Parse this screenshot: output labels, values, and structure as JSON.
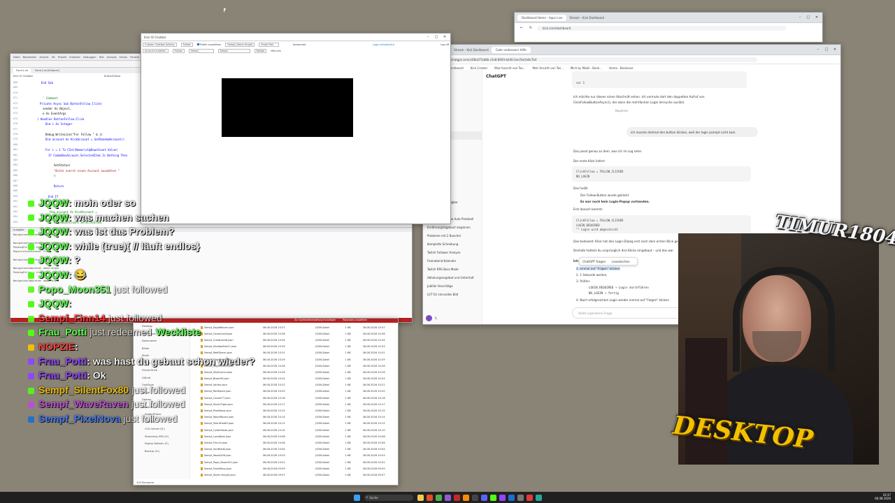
{
  "top_window": {
    "tabs": [
      "Dashboard Home - Aqua Live",
      "Stream - Kick Dashboard"
    ],
    "url": "kick.com/dashboard"
  },
  "kick_tool": {
    "title": "Kick IO Chatbot",
    "row1": [
      "Custom Chatbot Activity",
      "Follow",
      "Profile auswählen",
      "Sempf_Storm Knight",
      "Email Fehl"
    ],
    "row2": [
      "Account erstellen",
      "Follow",
      "Sempf_",
      "Sempf",
      "Reload",
      "Miliz.dm"
    ],
    "status_label": "Verwendet",
    "status_value": "Login erforderlich",
    "logout": "Log off"
  },
  "ide": {
    "menu": [
      "Datei",
      "Bearbeiten",
      "Ansicht",
      "Git",
      "Projekt",
      "Erstellen",
      "Debuggen",
      "Test",
      "Analyse",
      "Extras",
      "Fenster",
      "Hilfe"
    ],
    "tab": "Form1.vb",
    "tab2": "Form1.vb [Entwurf]",
    "dropdown_left": "Kick IO Chatbot",
    "dropdown_right": "ButtonFollow",
    "line_numbers": [
      "668",
      "669",
      "670",
      "671",
      "672",
      "673",
      "674",
      "675",
      "676",
      "677",
      "678",
      "679",
      "680",
      "681",
      "682",
      "683",
      "684",
      "685",
      "686",
      "687",
      "688",
      "689",
      "690",
      "691",
      "692",
      "693",
      "694",
      "695"
    ],
    "code": [
      "End Sub",
      "",
      "",
      "' Comment",
      "Private Async Sub ButtonFollow_Click(",
      "sender As Object,",
      "e As EventArgs",
      ") Handles ButtonFollow.Click",
      "Dim i As Integer",
      "",
      "Debug.WriteLine(\"For Follow \" & i)",
      "Dim account As KickAccount = GetRandomAccount()",
      "",
      "For i = 1 To CInt(NumericUpDownCount.Value)",
      "If ComboBoxAccount.SelectedItem Is Nothing Then",
      "",
      "SetStatus(",
      "\"Bitte zuerst einen Account auswählen \"",
      ")",
      "",
      "Return",
      "",
      "End If",
      "",
      "",
      "'Dim account As KickAccount =",
      "CType(CType(",
      "ComboBoxAccount.SelectedItem,"
    ],
    "output_title": "Ausgabe",
    "output_lines": [
      "NavigationCompleted: about:blank",
      "",
      "NavigationCompleted: about:blank",
      "PendingFollow = true",
      "RegistrationSuccess: True",
      "",
      "NavigationCompleted: about:blank",
      "",
      "NavigationCompleted: about:blank",
      "PendingFollow = true",
      "",
      "NavigationCompleted: about:blank"
    ]
  },
  "chat": {
    "lines": [
      {
        "user": "JQQW",
        "msg": ": moin oder so",
        "type": "msg"
      },
      {
        "user": "JQQW",
        "msg": ": was machen sachen",
        "type": "msg"
      },
      {
        "user": "JQQW",
        "msg": ": was ist das Problem?",
        "type": "msg"
      },
      {
        "user": "JQQW",
        "msg": ": while (true){ // läuft endlos}",
        "type": "msg"
      },
      {
        "user": "JQQW",
        "msg": ": ?",
        "type": "msg"
      },
      {
        "user": "JQQW",
        "msg": ": 😂",
        "type": "msg"
      },
      {
        "user": "Popo_Moon351",
        "msg": "just followed",
        "type": "follow"
      },
      {
        "user": "JQQW",
        "msg": ":",
        "type": "msg"
      },
      {
        "user": "Sempf_Finn14",
        "msg": "just followed",
        "type": "follow"
      },
      {
        "user": "Frau_Potti",
        "msg": "just redeemed",
        "type": "redeem",
        "extra": "Weckliste"
      },
      {
        "user": "NOPZIE",
        "msg": ":",
        "type": "msg"
      },
      {
        "user": "Frau_Potti",
        "msg": ": was hast du gebaut schon wieder?",
        "type": "msg"
      },
      {
        "user": "Frau_Potti",
        "msg": ": Ok",
        "type": "msg"
      },
      {
        "user": "Sempf_SilentFox80",
        "msg": "just followed",
        "type": "follow"
      },
      {
        "user": "Sempf_WaveRaven",
        "msg": "just followed",
        "type": "follow"
      },
      {
        "user": "Sempf_PixelNova",
        "msg": "just followed",
        "type": "follow"
      }
    ]
  },
  "explorer": {
    "sidebar": [
      "Desktop",
      "Downloads",
      "Dokumente",
      "Bilder",
      "Musik",
      "Videos",
      "iCloud Drive",
      "Github",
      "OneDrive",
      "Spiele",
      "Games",
      "Dieser PC",
      "Apple iPhone",
      "SSD (C:)",
      "CLD Games (D:)",
      "Streaming SSD (E:)",
      "Eigene Dateien (F:)",
      "Backup (G:)"
    ],
    "files": [
      [
        "Sempf_EagleBloom.json",
        "06.08.2026 10:37",
        "JSON-Datei",
        "1 KB",
        "06.08.2026 10:37"
      ],
      [
        "Sempf_OceanLeaf.json",
        "06.08.2026 10:36",
        "JSON-Datei",
        "1 KB",
        "06.08.2026 10:36"
      ],
      [
        "Sempf_CrestLeon8.json",
        "06.08.2026 10:34",
        "JSON-Datei",
        "1 KB",
        "06.08.2026 10:34"
      ],
      [
        "Sempf_ShadowFox21.json",
        "06.08.2026 10:33",
        "JSON-Datei",
        "1 KB",
        "06.08.2026 10:33"
      ],
      [
        "Sempf_WolfStorm.json",
        "06.08.2026 10:31",
        "JSON-Datei",
        "1 KB",
        "06.08.2026 10:31"
      ],
      [
        "Sempf_GlowRider.json",
        "06.08.2026 10:29",
        "JSON-Datei",
        "1 KB",
        "06.08.2026 10:29"
      ],
      [
        "Sempf_NightFalcon.json",
        "06.08.2026 10:28",
        "JSON-Datei",
        "1 KB",
        "06.08.2026 10:28"
      ],
      [
        "Sempf_SkyRunner.json",
        "06.08.2026 10:26",
        "JSON-Datei",
        "1 KB",
        "06.08.2026 10:26"
      ],
      [
        "Sempf_Blaze99.json",
        "06.08.2026 10:24",
        "JSON-Datei",
        "1 KB",
        "06.08.2026 10:24"
      ],
      [
        "Sempf_Vortex.json",
        "06.08.2026 10:22",
        "JSON-Datei",
        "1 KB",
        "06.08.2026 10:22"
      ],
      [
        "Sempf_RedSpark.json",
        "06.08.2026 10:20",
        "JSON-Datei",
        "1 KB",
        "06.08.2026 10:20"
      ],
      [
        "Sempf_Comet77.json",
        "06.08.2026 10:18",
        "JSON-Datei",
        "1 KB",
        "06.08.2026 10:18"
      ],
      [
        "Sempf_StormTiger.json",
        "06.08.2026 10:17",
        "JSON-Datei",
        "1 KB",
        "06.08.2026 10:17"
      ],
      [
        "Sempf_PixelNova.json",
        "06.08.2026 10:15",
        "JSON-Datei",
        "1 KB",
        "06.08.2026 10:15"
      ],
      [
        "Sempf_WaveRaven.json",
        "06.08.2026 10:14",
        "JSON-Datei",
        "1 KB",
        "06.08.2026 10:14"
      ],
      [
        "Sempf_SilentFox80.json",
        "06.08.2026 10:12",
        "JSON-Datei",
        "1 KB",
        "06.08.2026 10:12"
      ],
      [
        "Sempf_CyberHawk.json",
        "06.08.2026 10:10",
        "JSON-Datei",
        "1 KB",
        "06.08.2026 10:10"
      ],
      [
        "Sempf_LunaByte.json",
        "06.08.2026 10:08",
        "JSON-Datei",
        "1 KB",
        "06.08.2026 10:08"
      ],
      [
        "Sempf_Finn14.json",
        "06.08.2026 10:06",
        "JSON-Datei",
        "1 KB",
        "06.08.2026 10:06"
      ],
      [
        "Sempf_IronBlade.json",
        "06.08.2026 10:04",
        "JSON-Datei",
        "1 KB",
        "06.08.2026 10:04"
      ],
      [
        "Sempf_NeonDrift.json",
        "06.08.2026 10:03",
        "JSON-Datei",
        "1 KB",
        "06.08.2026 10:03"
      ],
      [
        "Sempf_Popo_Moon351.json",
        "06.08.2026 10:01",
        "JSON-Datei",
        "1 KB",
        "06.08.2026 10:01"
      ],
      [
        "Sempf_FrostWing.json",
        "06.08.2026 09:59",
        "JSON-Datei",
        "1 KB",
        "06.08.2026 09:59"
      ],
      [
        "Sempf_Storm Knight.json",
        "06.08.2026 09:57",
        "JSON-Datei",
        "1 KB",
        "06.08.2026 09:57"
      ]
    ],
    "status": "103 Elemente",
    "toolbar_items": [
      "Zur Quellcodeverwaltung hinzufügen",
      "Repository auswählen"
    ]
  },
  "browser": {
    "tabs": [
      "Stream - Kick Dashboard",
      "Code verbessern Hilfe"
    ],
    "url": "chatgpt.com/c/68a1f7ab8b-c5e8-8093-b4d0-2ee7be5e8c7b4",
    "bookmarks": [
      "Stream - Kick Dashboard",
      "Kick Creator",
      "Mod Ansicht von Twi...",
      "Meh Ansicht von Twi...",
      "Mich by Mobil - Bank...",
      "Home - Bookrose"
    ],
    "app_title": "ChatGPT",
    "sidebar": [
      "Neuer Chat",
      "Chats durchsuchen",
      "Bibliothek",
      "Sora",
      "GPTs",
      "Codex",
      "Projekte",
      "Kick IO Hilfe",
      "Chats",
      "Kick Follower",
      "Stream Aufbau",
      "Follower-Bot gut",
      "Login Timing",
      "ChatGPT OpenAI",
      "Kick Chatbot API",
      "Discord Bot Verfügbar",
      "Kick Raid Bank",
      "Gewichtsabnahme Auto Protokoll",
      "Ernährungstagebuch beginnen",
      "Probleme mit 2 Buecher",
      "Komplette Schreibung",
      "Twitch Follower Analyse",
      "Feierabend Kalender",
      "Twitch RPG Boss Mode",
      "Abholungsangebot und Unterhalt",
      "Jubiläe Vorschläge",
      "LUT für sinnvolles Bild"
    ],
    "messages": {
      "code_top": "var 1",
      "p1": "Ich möchte nur diesen einen Abschnitt sehen. Ich vermute dort den doppelten Aufruf von",
      "p1b": "ClickFollowButtonAsync(), der dann die mehrfachen Login Versuche auslöst.",
      "copy_label": "Kopieren",
      "user_msg": "ich musste dreimal den button klicken, weil der login prompt nicht kam",
      "r1": "Das passt genau zu dem, was ich im Log sehe:",
      "r2": "Der erste Klick liefert:",
      "code1": "ClickFollow = FOLLOW_CLICKED",
      "code1b": "NO_LOGIN",
      "r3": "Das heißt:",
      "b1": "Der Follow-Button wurde geklickt",
      "b2": "Es war noch kein Login-Popup vorhanden.",
      "r4": "Erst danach kommt:",
      "code2": "ClickFollow = FOLLOW_CLICKED",
      "code2b": "LOGIN_REQUIRED",
      "code2c": "\"\" Login wird abgeschickt",
      "r5": "Das bedeutet: Klick hat den Login-Dialog erst nach dem ersten Klick geöffnet.",
      "r6": "Deshalb hattest du ursprünglich drei Klicks eingebaut – und das war",
      "r7": "Ich",
      "n1": "einmal auf \"Folgen\" klicken",
      "n2": "1 Sekunde warten,",
      "n3": "Prüfen:",
      "n3a": "LOGIN_REQUIRED → Login durchführen",
      "n3b": "NO_LOGIN → fertig",
      "n4": "Nach erfolgreichem Login wieder einmal auf \"Folgen\" klicken",
      "popup1": "ChatGPT fragen",
      "popup2": "Lesezeichen",
      "input_placeholder": "Stelle irgendeine Frage"
    },
    "user_label": "S.",
    "user_sub": "Plus"
  },
  "overlay": {
    "logo_top": "TIMUR1804",
    "logo_bottom": "DESKTOP"
  },
  "taskbar": {
    "search_placeholder": "Suche",
    "time": "10:37",
    "date": "06.08.2026"
  },
  "colors": {
    "desktop": "#8a8476",
    "kick_green": "#53fc18",
    "accent_blue": "#1a6fd1"
  }
}
